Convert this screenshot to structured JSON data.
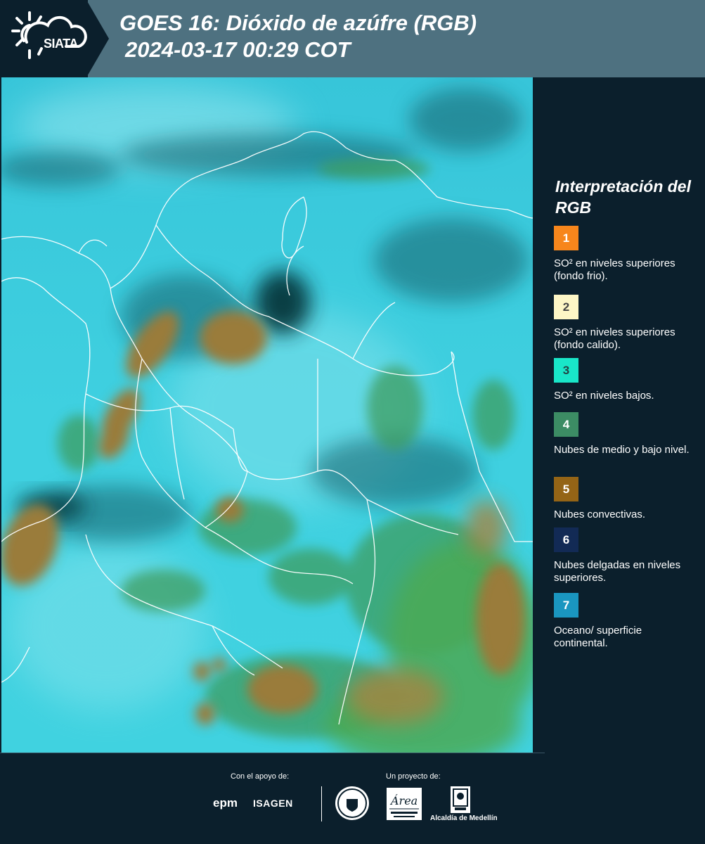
{
  "header": {
    "logo_text": "SIATA",
    "title_line1": "GOES 16: Dióxido de azúfre (RGB)",
    "title_line2": "2024-03-17 00:29 COT"
  },
  "legend": {
    "title": "Interpretación del RGB",
    "items": [
      {
        "number": "1",
        "label": "SO² en niveles superiores (fondo frio).",
        "color": "#f7861c",
        "text_color": "#ffffff"
      },
      {
        "number": "2",
        "label": "SO² en niveles superiores (fondo calido).",
        "color": "#fdf6c6",
        "text_color": "#444444"
      },
      {
        "number": "3",
        "label": "SO² en niveles bajos.",
        "color": "#19e6c8",
        "text_color": "#244444"
      },
      {
        "number": "4",
        "label": "Nubes de medio y bajo nivel.",
        "color": "#3c8c64",
        "text_color": "#ffffff"
      },
      {
        "number": "5",
        "label": "Nubes convectivas.",
        "color": "#946416",
        "text_color": "#ffffff"
      },
      {
        "number": "6",
        "label": "Nubes delgadas en niveles superiores.",
        "color": "#122a55",
        "text_color": "#ffffff"
      },
      {
        "number": "7",
        "label": "Oceano/ superficie continental.",
        "color": "#1a96c0",
        "text_color": "#ffffff"
      }
    ]
  },
  "footer": {
    "support_label": "Con el apoyo de:",
    "project_label": "Un proyecto de:",
    "sponsor1": "epm",
    "sponsor2": "ISAGEN",
    "partner_alcaldia": "Alcaldía de Medellín"
  },
  "map": {
    "description_colors": {
      "ocean": "#33c6dc",
      "convective": "#a07a3c",
      "low_cloud": "#3c9a5a",
      "thin_high": "#0f3340",
      "border": "#ffffff"
    }
  }
}
